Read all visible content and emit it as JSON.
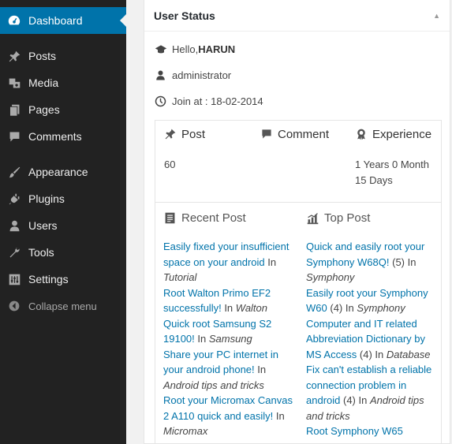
{
  "sidebar": {
    "dashboard": {
      "label": "Dashboard",
      "icon": "dashboard-icon"
    },
    "items_a": [
      {
        "label": "Posts",
        "icon": "pin-icon"
      },
      {
        "label": "Media",
        "icon": "media-icon"
      },
      {
        "label": "Pages",
        "icon": "pages-icon"
      },
      {
        "label": "Comments",
        "icon": "comment-icon"
      }
    ],
    "items_b": [
      {
        "label": "Appearance",
        "icon": "brush-icon"
      },
      {
        "label": "Plugins",
        "icon": "plug-icon"
      },
      {
        "label": "Users",
        "icon": "user-icon"
      },
      {
        "label": "Tools",
        "icon": "wrench-icon"
      },
      {
        "label": "Settings",
        "icon": "sliders-icon"
      }
    ],
    "collapse_label": "Collapse menu"
  },
  "widget": {
    "title": "User Status",
    "hello_prefix": "Hello,",
    "username": "HARUN",
    "role": "administrator",
    "join": "Join at : 18-02-2014",
    "stats": {
      "post_label": "Post",
      "comment_label": "Comment",
      "experience_label": "Experience",
      "post_value": "60",
      "experience_line1": "1 Years 0 Month",
      "experience_line2": "15 Days"
    },
    "recent_post_label": "Recent Post",
    "top_post_label": "Top Post",
    "recent_posts": [
      {
        "title": "Easily fixed your insufficient space on your android",
        "category": "Tutorial"
      },
      {
        "title": "Root Walton Primo EF2 successfully!",
        "category": "Walton"
      },
      {
        "title": "Quick root Samsung S2 19100!",
        "category": "Samsung"
      },
      {
        "title": "Share your PC internet in your android phone!",
        "category": "Android tips and tricks"
      },
      {
        "title": "Root your Micromax Canvas 2 A110 quick and easily!",
        "category": "Micromax"
      }
    ],
    "top_posts": [
      {
        "title": "Quick and easily root your Symphony W68Q!",
        "count": "(5)",
        "category": "Symphony"
      },
      {
        "title": "Easily root your Symphony W60",
        "count": "(4)",
        "category": "Symphony"
      },
      {
        "title": "Computer and IT related Abbreviation Dictionary by MS Access",
        "count": "(4)",
        "category": "Database"
      },
      {
        "title": "Fix can't establish a reliable connection problem in android",
        "count": "(4)",
        "category": "Android tips and tricks"
      },
      {
        "title": "Root Symphony W65",
        "count": "",
        "category": ""
      }
    ]
  }
}
